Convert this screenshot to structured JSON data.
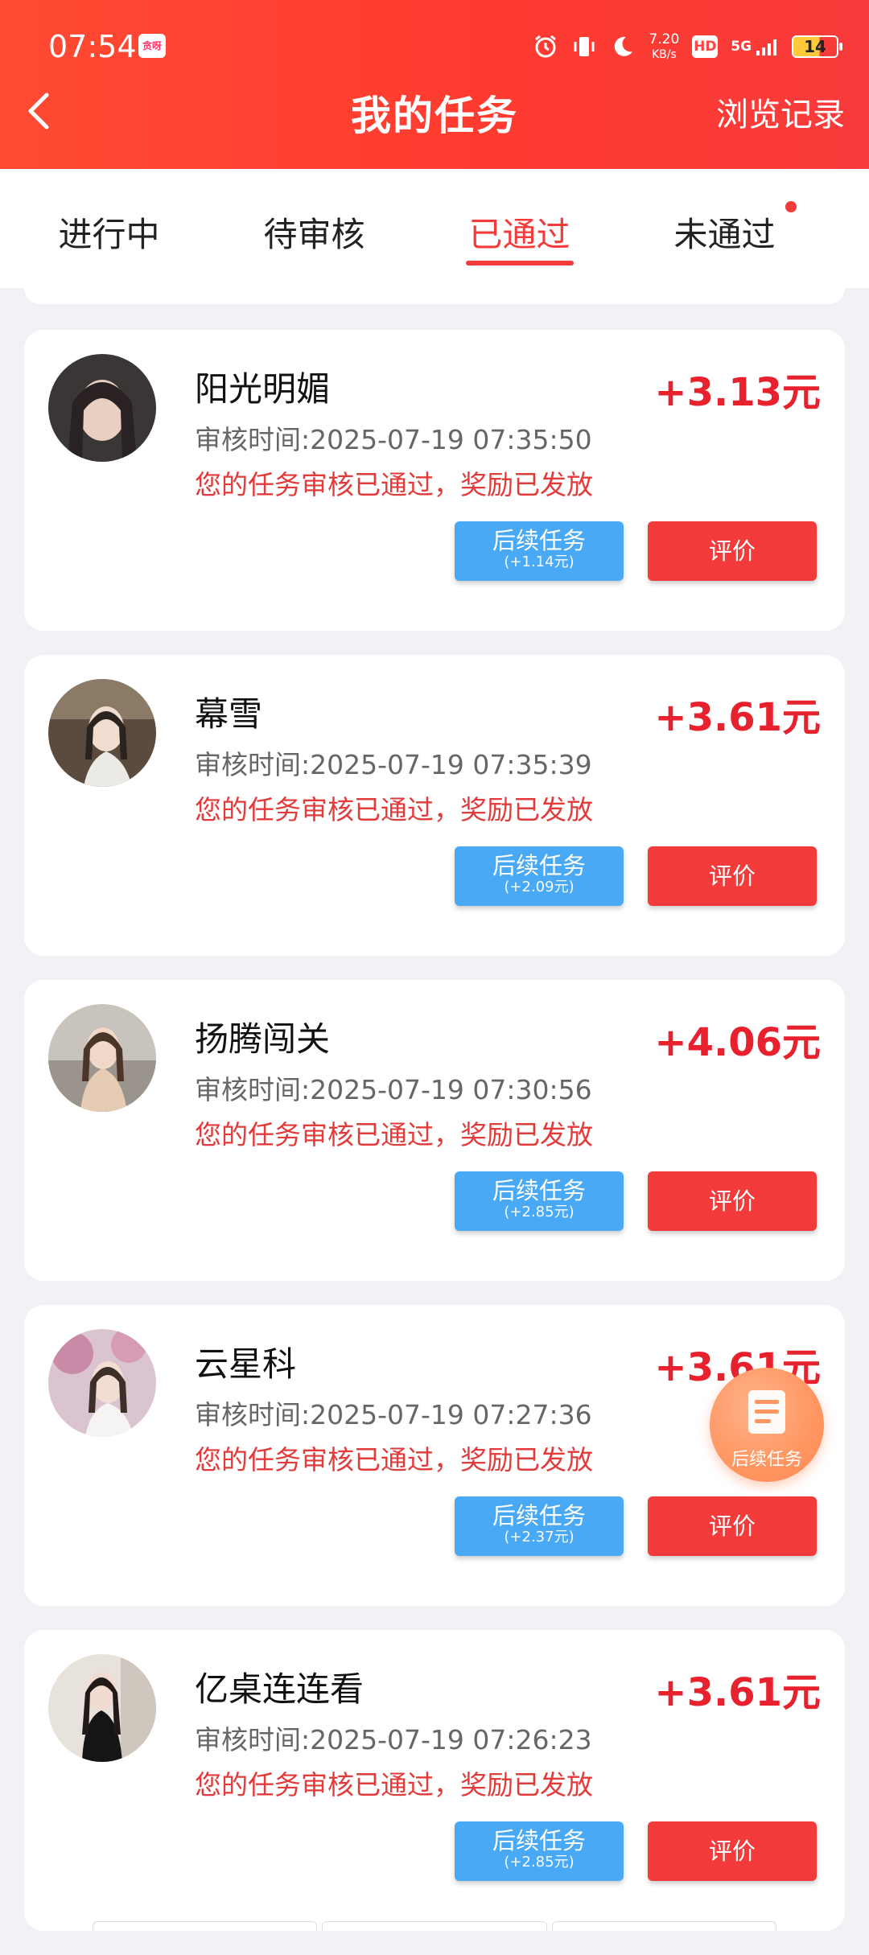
{
  "status_bar": {
    "time": "07:54",
    "app_badge": "贪呀",
    "net_speed_value": "7.20",
    "net_speed_unit": "KB/s",
    "hd": "HD",
    "network": "5G",
    "battery": "14"
  },
  "nav": {
    "title": "我的任务",
    "history": "浏览记录"
  },
  "tabs": [
    {
      "label": "进行中"
    },
    {
      "label": "待审核"
    },
    {
      "label": "已通过",
      "active": true
    },
    {
      "label": "未通过",
      "has_dot": true
    }
  ],
  "tasks": [
    {
      "name": "阳光明媚",
      "amount": "+3.13元",
      "review_time": "审核时间:2025-07-19 07:35:50",
      "status": "您的任务审核已通过，奖励已发放",
      "follow_label": "后续任务",
      "follow_bonus": "(+1.14元)",
      "rate_label": "评价"
    },
    {
      "name": "幕雪",
      "amount": "+3.61元",
      "review_time": "审核时间:2025-07-19 07:35:39",
      "status": "您的任务审核已通过，奖励已发放",
      "follow_label": "后续任务",
      "follow_bonus": "(+2.09元)",
      "rate_label": "评价"
    },
    {
      "name": "扬腾闯关",
      "amount": "+4.06元",
      "review_time": "审核时间:2025-07-19 07:30:56",
      "status": "您的任务审核已通过，奖励已发放",
      "follow_label": "后续任务",
      "follow_bonus": "(+2.85元)",
      "rate_label": "评价"
    },
    {
      "name": "云星科",
      "amount": "+3.61元",
      "review_time": "审核时间:2025-07-19 07:27:36",
      "status": "您的任务审核已通过，奖励已发放",
      "follow_label": "后续任务",
      "follow_bonus": "(+2.37元)",
      "rate_label": "评价"
    },
    {
      "name": "亿桌连连看",
      "amount": "+3.61元",
      "review_time": "审核时间:2025-07-19 07:26:23",
      "status": "您的任务审核已通过，奖励已发放",
      "follow_label": "后续任务",
      "follow_bonus": "(+2.85元)",
      "rate_label": "评价"
    }
  ],
  "float_button": {
    "label": "后续任务",
    "icon": "document-list-icon"
  },
  "colors": {
    "header_red": "#ff3b30",
    "accent_red": "#f33b3b",
    "amount_red": "#e8212e",
    "follow_blue": "#4aa9f5",
    "float_orange": "#ff9661",
    "background": "#f2f2f6"
  }
}
